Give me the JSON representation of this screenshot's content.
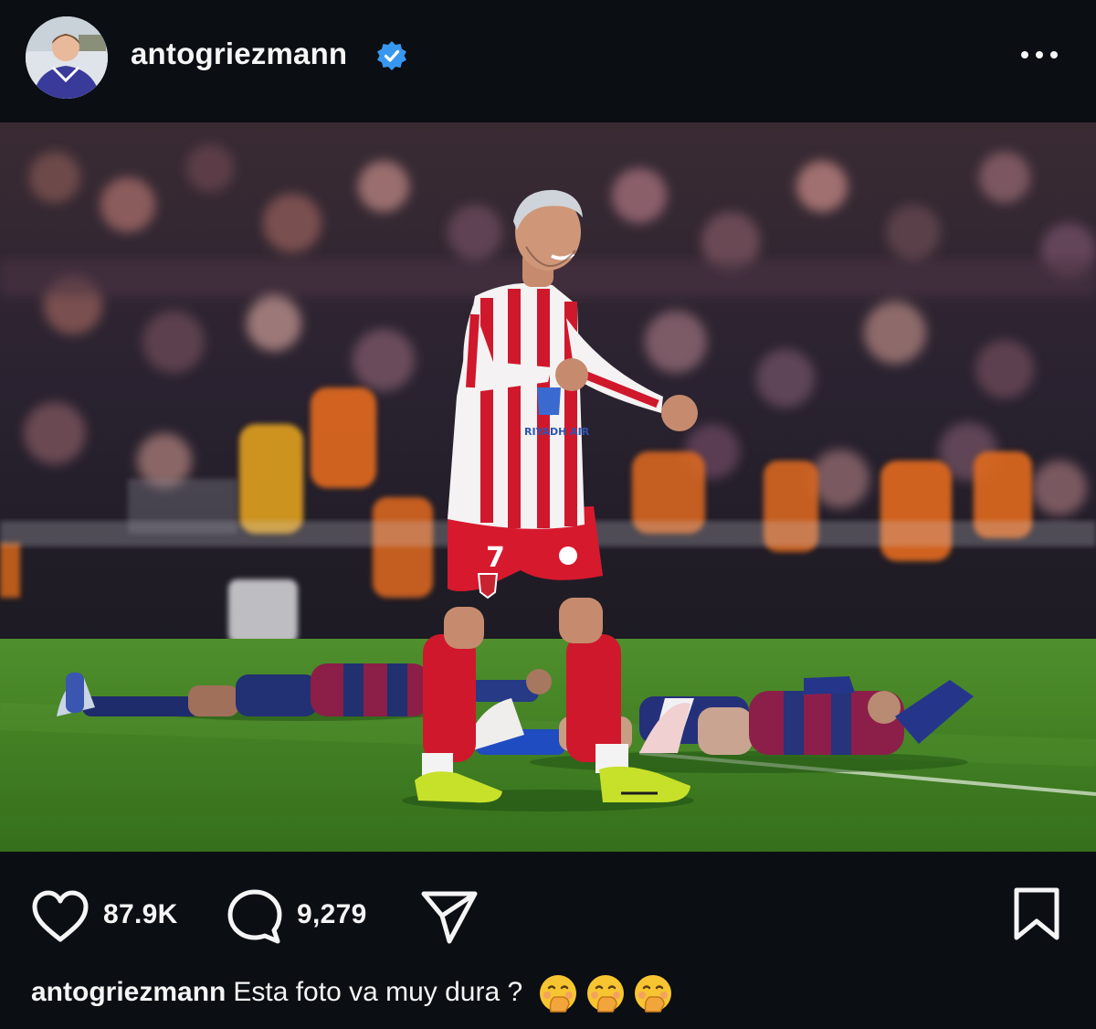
{
  "post": {
    "username": "antogriezmann",
    "verified": true,
    "likes": "87.9K",
    "comments": "9,279",
    "caption": {
      "username": "antogriezmann",
      "text": "Esta foto va muy dura ?",
      "emojis": [
        "hand-over-mouth-emoji",
        "hand-over-mouth-emoji",
        "hand-over-mouth-emoji"
      ]
    }
  },
  "photo": {
    "jersey_number": "7",
    "sponsor_text": "RIYADH AIR"
  },
  "icons": {
    "like": "heart-icon",
    "comment": "comment-bubble-icon",
    "share": "paper-plane-icon",
    "save": "bookmark-icon",
    "more": "more-dots-icon",
    "verified": "verified-badge-icon"
  },
  "colors": {
    "background": "#0b0e12",
    "text": "#f5f5f5",
    "verified_blue": "#3897f0",
    "atletico_red": "#d0182c",
    "barca_blue": "#1f2c6b",
    "pitch_green": "#3f8a22",
    "boots_yellow": "#c7e02a"
  }
}
